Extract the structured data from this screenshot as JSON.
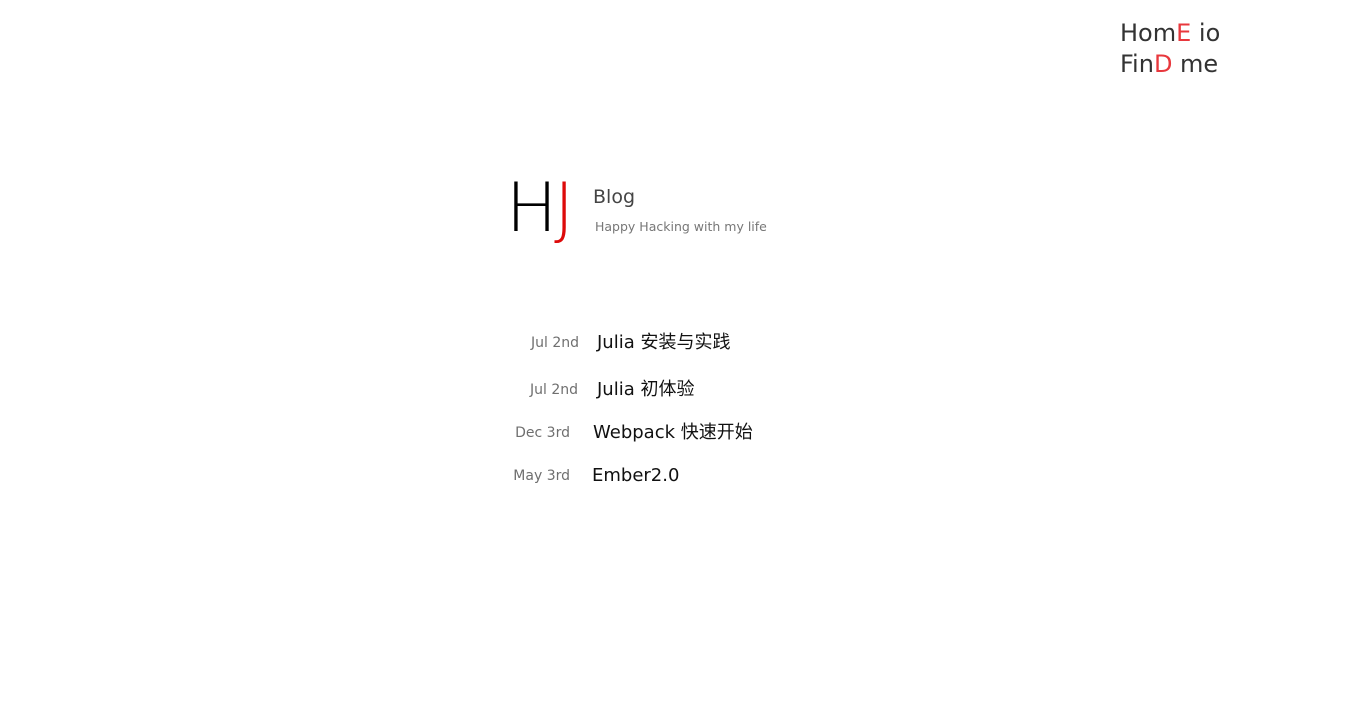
{
  "nav": {
    "home": {
      "before": "Hom",
      "accent": "E",
      "after": " io"
    },
    "find": {
      "before": "Fin",
      "accent": "D",
      "after": " me"
    }
  },
  "brand": {
    "logo_h": "H",
    "logo_j": "J",
    "title": "Blog",
    "subtitle": "Happy Hacking with my life"
  },
  "posts": [
    {
      "date": "Jul 2nd",
      "title": "Julia 安装与实践"
    },
    {
      "date": "Jul 2nd",
      "title": "Julia 初体验"
    },
    {
      "date": "Dec 3rd",
      "title": "Webpack 快速开始"
    },
    {
      "date": "May 3rd",
      "title": "Ember2.0"
    }
  ],
  "colors": {
    "accent": "#e8383d",
    "logo_j": "#dd0a0a",
    "text": "#333333"
  }
}
